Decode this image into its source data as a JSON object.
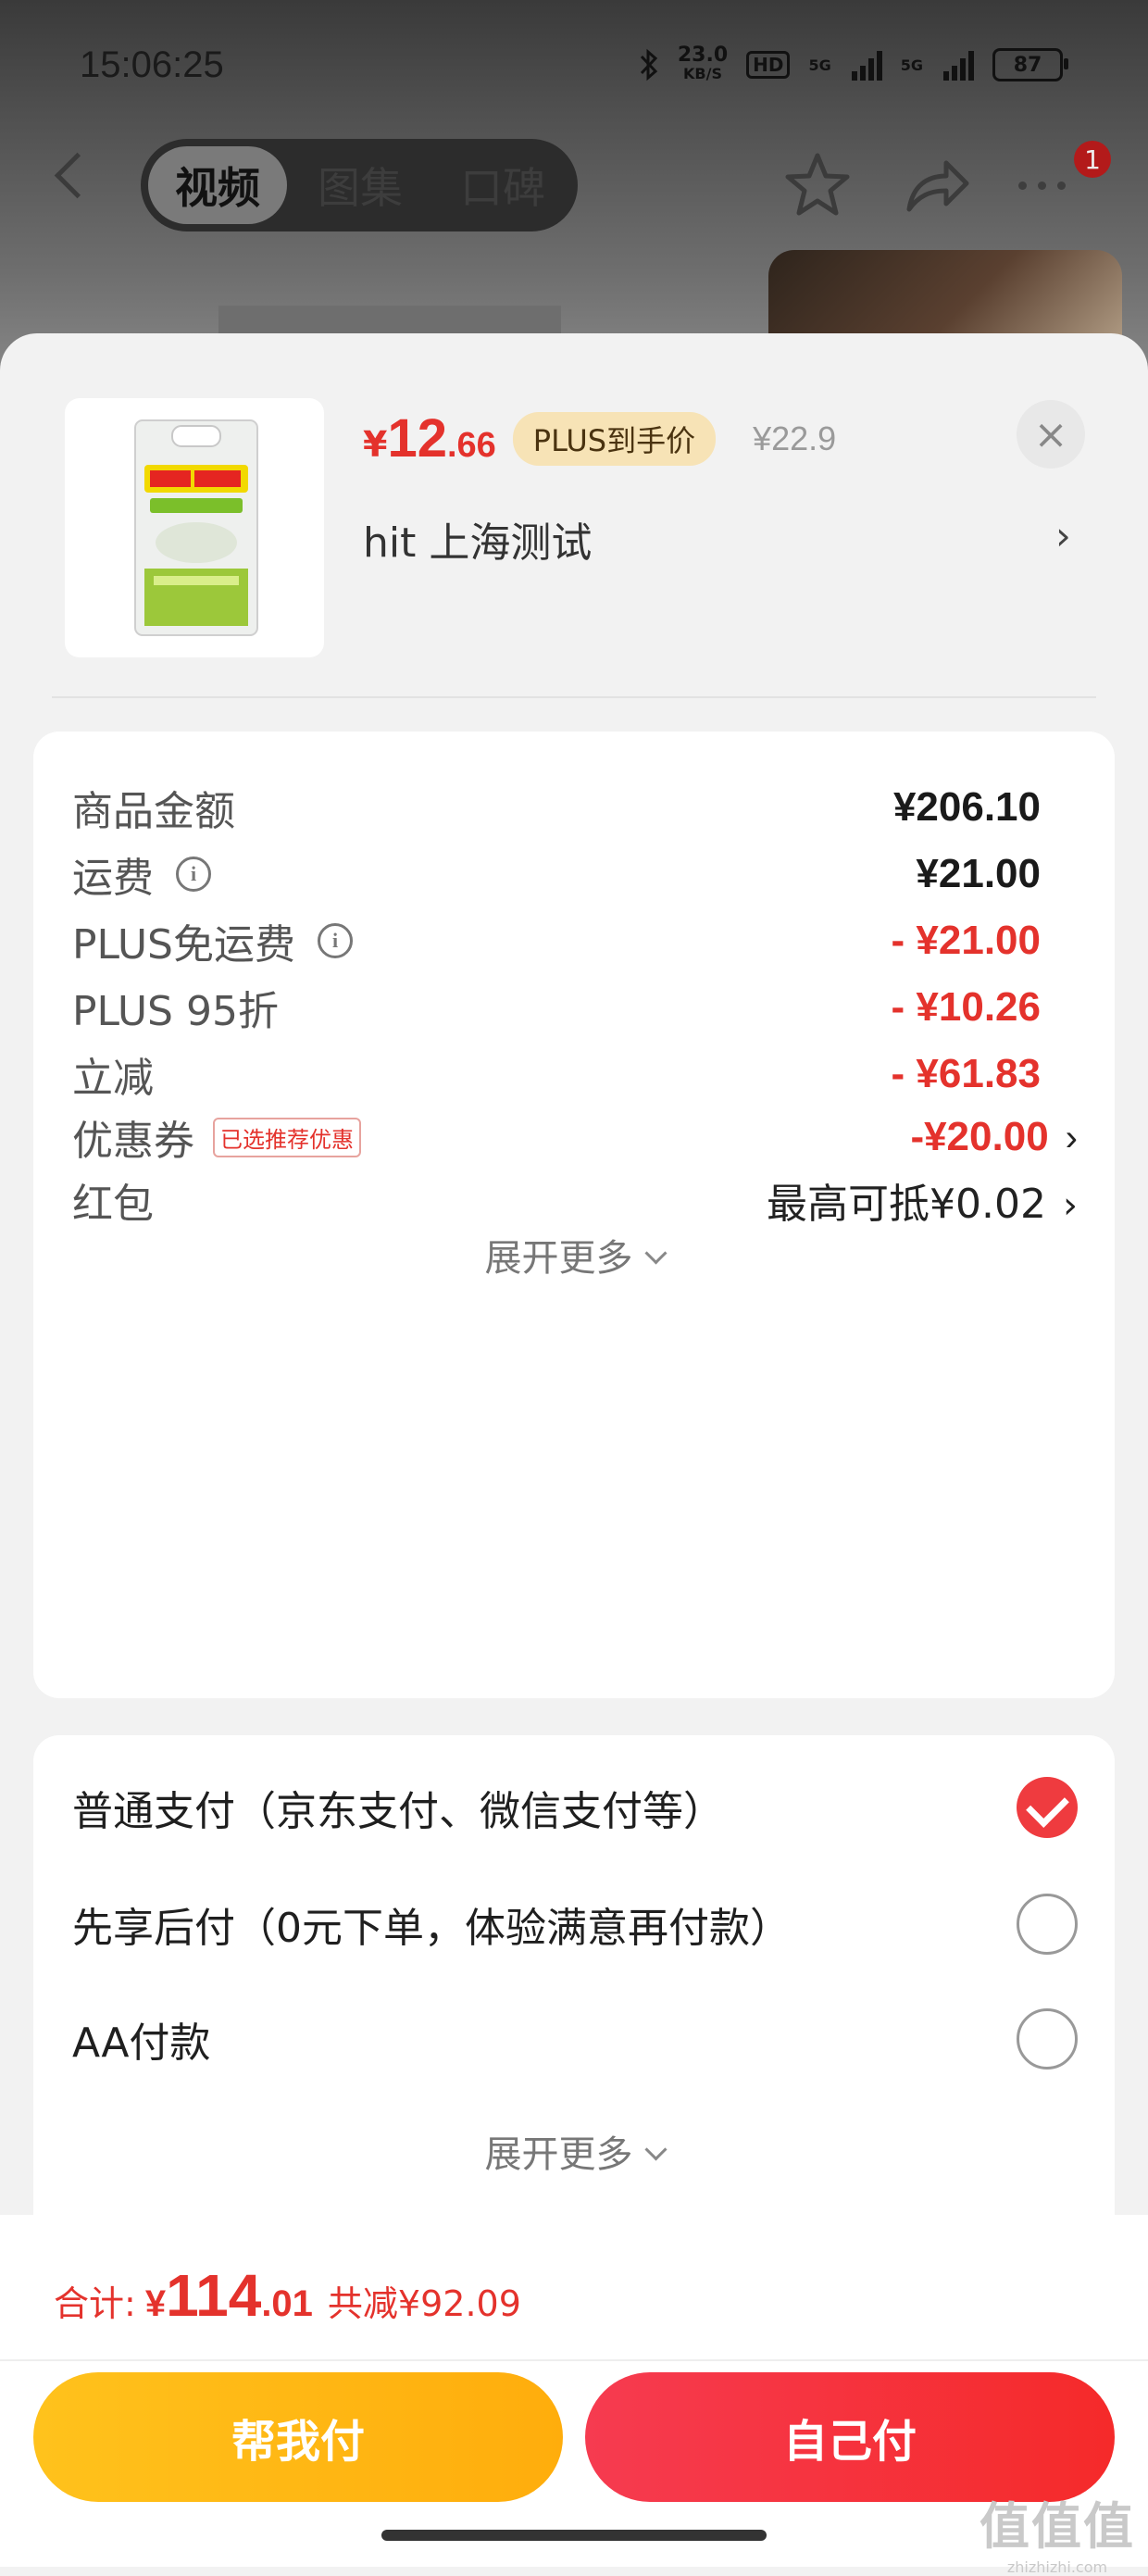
{
  "status_bar": {
    "time": "15:06:25",
    "net_speed": "23.0",
    "net_unit": "KB/S",
    "hd": "HD",
    "sig1": "5G",
    "sig2": "5G",
    "battery": "87"
  },
  "nav": {
    "tabs": [
      {
        "label": "视频",
        "active": true
      },
      {
        "label": "图集",
        "active": false
      },
      {
        "label": "口碑",
        "active": false
      }
    ],
    "badge": "1"
  },
  "product": {
    "price_symbol": "¥",
    "price_int": "12",
    "price_dec": ".66",
    "plus_badge": "PLUS到手价",
    "original_price": "¥22.9",
    "close": "×",
    "address": "hit  上海测试",
    "address_chevron": "›"
  },
  "fees": [
    {
      "label": "商品金额",
      "value": "¥206.10",
      "style": "bold"
    },
    {
      "label": "运费",
      "value": "¥21.00",
      "style": "bold",
      "info": true
    },
    {
      "label": "PLUS免运费",
      "value": "- ¥21.00",
      "style": "red",
      "info": true
    },
    {
      "label": "PLUS 95折",
      "value": "- ¥10.26",
      "style": "red"
    },
    {
      "label": "立减",
      "value": "- ¥61.83",
      "style": "red"
    },
    {
      "label": "优惠券",
      "tag": "已选推荐优惠",
      "value": "-¥20.00",
      "style": "red",
      "chevron": true
    },
    {
      "label": "红包",
      "value": "最高可抵¥0.02",
      "style": "plain",
      "chevron": true
    }
  ],
  "fees_expand": "展开更多",
  "payments": [
    {
      "label": "普通支付（京东支付、微信支付等）",
      "checked": true
    },
    {
      "label": "先享后付（0元下单，体验满意再付款）",
      "checked": false
    },
    {
      "label": "AA付款",
      "checked": false
    }
  ],
  "payments_expand": "展开更多",
  "total": {
    "label": "合计:",
    "yen": "¥",
    "int": "114",
    "dec": ".01",
    "saved": "共减¥92.09"
  },
  "buttons": {
    "help_pay": "帮我付",
    "self_pay": "自己付"
  },
  "watermark": {
    "big": "值值值",
    "small": "zhizhizhi.com"
  },
  "colors": {
    "accent_red": "#e4322c",
    "button_yellow": "#ffb716",
    "button_red": "#f5343a"
  }
}
